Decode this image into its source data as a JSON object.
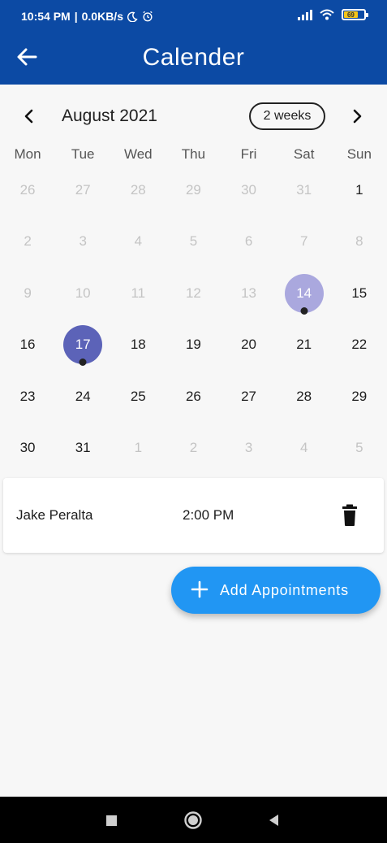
{
  "status_bar": {
    "time": "10:54 PM",
    "speed": "0.0KB/s",
    "battery": "69"
  },
  "app_bar": {
    "title": "Calender",
    "back_icon": "arrow-left-icon"
  },
  "calendar": {
    "month_label": "August 2021",
    "format_button": "2 weeks",
    "weekdays": [
      "Mon",
      "Tue",
      "Wed",
      "Thu",
      "Fri",
      "Sat",
      "Sun"
    ],
    "weeks": [
      [
        "26",
        "27",
        "28",
        "29",
        "30",
        "31",
        "1"
      ],
      [
        "2",
        "3",
        "4",
        "5",
        "6",
        "7",
        "8"
      ],
      [
        "9",
        "10",
        "11",
        "12",
        "13",
        "14",
        "15"
      ],
      [
        "16",
        "17",
        "18",
        "19",
        "20",
        "21",
        "22"
      ],
      [
        "23",
        "24",
        "25",
        "26",
        "27",
        "28",
        "29"
      ],
      [
        "30",
        "31",
        "1",
        "2",
        "3",
        "4",
        "5"
      ]
    ],
    "today": "14",
    "selected": "17",
    "colors": {
      "today_circle": "#aaa8de",
      "selected_circle": "#5c63b8",
      "outside_text": "#c4c4c4"
    }
  },
  "appointment": {
    "name": "Jake Peralta",
    "time": "2:00 PM",
    "delete_icon": "trash-icon"
  },
  "fab": {
    "label": "Add Appointments",
    "icon": "plus-icon",
    "color": "#2196f3"
  },
  "nav_bar": {
    "buttons": [
      "recents-square-icon",
      "home-circle-icon",
      "back-triangle-icon"
    ]
  },
  "theme": {
    "primary": "#0c4aa4"
  }
}
